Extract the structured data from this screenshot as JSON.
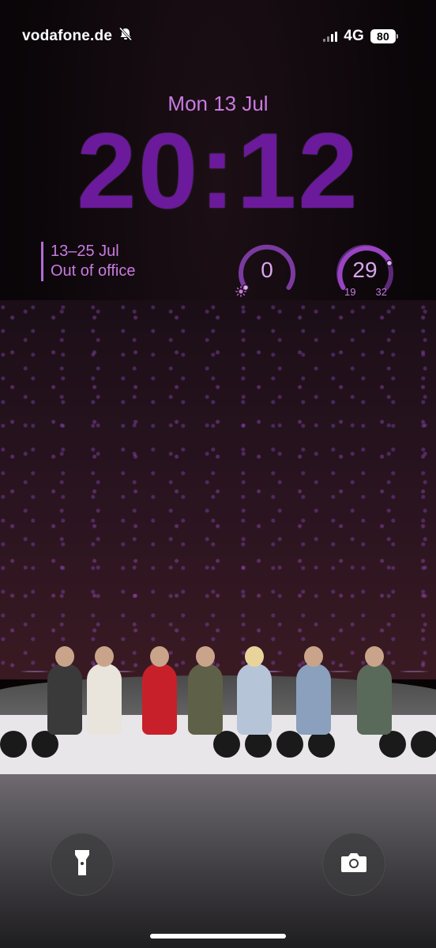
{
  "status_bar": {
    "carrier": "vodafone.de",
    "network": "4G",
    "battery": "80",
    "icons": [
      "bell-slash-icon",
      "signal-bars-icon",
      "battery-icon"
    ]
  },
  "lock_screen": {
    "date": "Mon 13 Jul",
    "time": "20:12"
  },
  "widgets": {
    "calendar": {
      "range": "13–25 Jul",
      "label": "Out of office"
    },
    "uv": {
      "value": "0",
      "icon": "sun-icon",
      "fraction": 0
    },
    "temperature": {
      "value": "29",
      "low": "19",
      "high": "32"
    }
  },
  "shortcuts": {
    "left": "flashlight-icon",
    "right": "camera-icon"
  },
  "colors": {
    "accent": "#c87be0",
    "time": "#6a1a9a",
    "ring": "#9a44c4"
  }
}
